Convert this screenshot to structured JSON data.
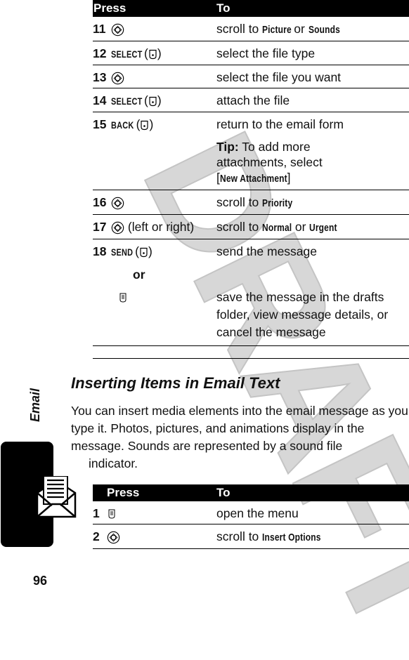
{
  "watermark": "DRAFT",
  "side_tab": {
    "label": "Email",
    "icon": "email-envelope-icon"
  },
  "page_number": "96",
  "table1": {
    "headers": {
      "press": "Press",
      "to": "To"
    },
    "rows": [
      {
        "num": "11",
        "key": "",
        "icon": "nav-key-icon",
        "extra": "",
        "to_pre": "scroll to ",
        "kw1": "Picture",
        "mid": " or ",
        "kw2": "Sounds",
        "to_post": ""
      },
      {
        "num": "12",
        "key": "SELECT",
        "icon": "soft-key-icon",
        "extra": "",
        "to_pre": "select the file type",
        "kw1": "",
        "mid": "",
        "kw2": "",
        "to_post": ""
      },
      {
        "num": "13",
        "key": "",
        "icon": "nav-key-icon",
        "extra": "",
        "to_pre": "select the file you want",
        "kw1": "",
        "mid": "",
        "kw2": "",
        "to_post": ""
      },
      {
        "num": "14",
        "key": "SELECT",
        "icon": "soft-key-icon",
        "extra": "",
        "to_pre": "attach the file",
        "kw1": "",
        "mid": "",
        "kw2": "",
        "to_post": ""
      },
      {
        "num": "15",
        "key": "BACK",
        "icon": "soft-key-icon",
        "extra": "",
        "to_pre": "return to the email form",
        "kw1": "",
        "mid": "",
        "kw2": "",
        "to_post": "",
        "tip_label": "Tip:",
        "tip_text": " To add more attachments, select ",
        "tip_keyword": "New Attachment"
      },
      {
        "num": "16",
        "key": "",
        "icon": "nav-key-icon",
        "extra": "",
        "to_pre": "scroll to ",
        "kw1": "Priority",
        "mid": "",
        "kw2": "",
        "to_post": ""
      },
      {
        "num": "17",
        "key": "",
        "icon": "nav-key-icon",
        "extra": " (left or right)",
        "to_pre": "scroll to ",
        "kw1": "Normal",
        "mid": " or ",
        "kw2": "Urgent",
        "to_post": ""
      },
      {
        "num": "18",
        "key": "SEND",
        "icon": "soft-key-icon",
        "extra": "",
        "to_pre": "send the message",
        "kw1": "",
        "mid": "",
        "kw2": "",
        "to_post": "",
        "or_label": "or",
        "alt_icon": "menu-key-icon",
        "alt_to": "save the message in the drafts folder, view message details, or cancel the message"
      }
    ]
  },
  "section": {
    "title": "Inserting Items in Email Text",
    "body_main": "You can insert media elements into the email message as you type it. Photos, pictures, and animations display in the message. Sounds are represented by a sound file",
    "body_tail": "indicator."
  },
  "table2": {
    "headers": {
      "num": "",
      "press": "Press",
      "to": "To"
    },
    "rows": [
      {
        "num": "1",
        "icon": "menu-key-icon",
        "to_pre": "open the menu",
        "kw1": ""
      },
      {
        "num": "2",
        "icon": "nav-key-icon",
        "to_pre": "scroll to ",
        "kw1": "Insert Options"
      }
    ]
  }
}
